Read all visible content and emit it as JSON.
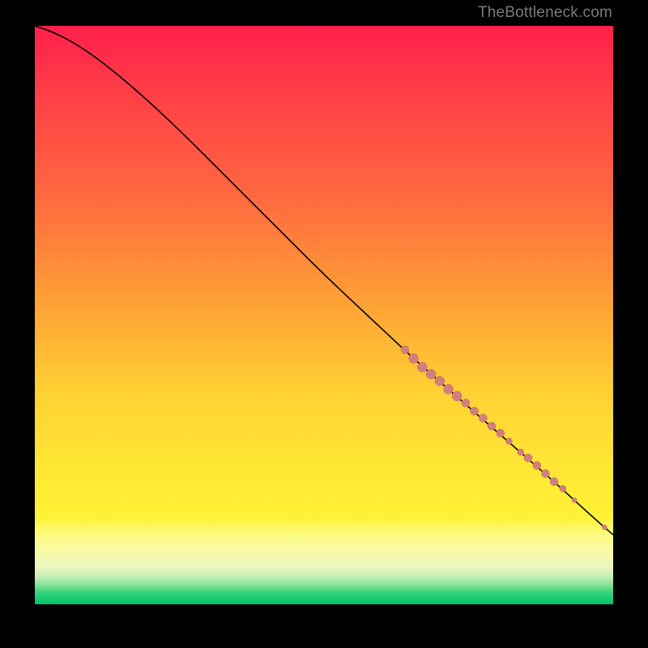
{
  "watermark": "TheBottleneck.com",
  "colors": {
    "dot_fill": "#d47e7d",
    "dot_stroke": "#b86e6c",
    "curve": "#000000"
  },
  "chart_data": {
    "type": "line",
    "title": "",
    "xlabel": "",
    "ylabel": "",
    "xlim": [
      0,
      100
    ],
    "ylim": [
      0,
      100
    ],
    "curve": [
      {
        "x": 0,
        "y": 100
      },
      {
        "x": 3,
        "y": 99
      },
      {
        "x": 7,
        "y": 97
      },
      {
        "x": 12,
        "y": 93.5
      },
      {
        "x": 18,
        "y": 88.5
      },
      {
        "x": 25,
        "y": 82
      },
      {
        "x": 33,
        "y": 74
      },
      {
        "x": 42,
        "y": 65
      },
      {
        "x": 50,
        "y": 57
      },
      {
        "x": 58,
        "y": 49.5
      },
      {
        "x": 66,
        "y": 42
      },
      {
        "x": 74,
        "y": 35
      },
      {
        "x": 82,
        "y": 28
      },
      {
        "x": 90,
        "y": 21
      },
      {
        "x": 96,
        "y": 15.5
      },
      {
        "x": 100,
        "y": 12
      }
    ],
    "scatter": [
      {
        "x": 64.0,
        "y": 44.0,
        "r": 5
      },
      {
        "x": 65.5,
        "y": 42.5,
        "r": 6
      },
      {
        "x": 67.0,
        "y": 41.0,
        "r": 6
      },
      {
        "x": 68.5,
        "y": 39.8,
        "r": 6
      },
      {
        "x": 70.0,
        "y": 38.6,
        "r": 6
      },
      {
        "x": 71.5,
        "y": 37.2,
        "r": 6
      },
      {
        "x": 73.0,
        "y": 36.0,
        "r": 6
      },
      {
        "x": 74.5,
        "y": 34.8,
        "r": 5
      },
      {
        "x": 76.0,
        "y": 33.4,
        "r": 5
      },
      {
        "x": 77.5,
        "y": 32.2,
        "r": 5
      },
      {
        "x": 79.0,
        "y": 30.8,
        "r": 5
      },
      {
        "x": 80.5,
        "y": 29.6,
        "r": 5
      },
      {
        "x": 82.0,
        "y": 28.2,
        "r": 4
      },
      {
        "x": 84.0,
        "y": 26.3,
        "r": 4
      },
      {
        "x": 85.3,
        "y": 25.3,
        "r": 5
      },
      {
        "x": 86.8,
        "y": 24.0,
        "r": 5
      },
      {
        "x": 88.3,
        "y": 22.6,
        "r": 5
      },
      {
        "x": 89.8,
        "y": 21.2,
        "r": 5
      },
      {
        "x": 91.3,
        "y": 20.0,
        "r": 4
      },
      {
        "x": 93.3,
        "y": 18.0,
        "r": 3
      },
      {
        "x": 98.5,
        "y": 13.3,
        "r": 3
      }
    ]
  }
}
